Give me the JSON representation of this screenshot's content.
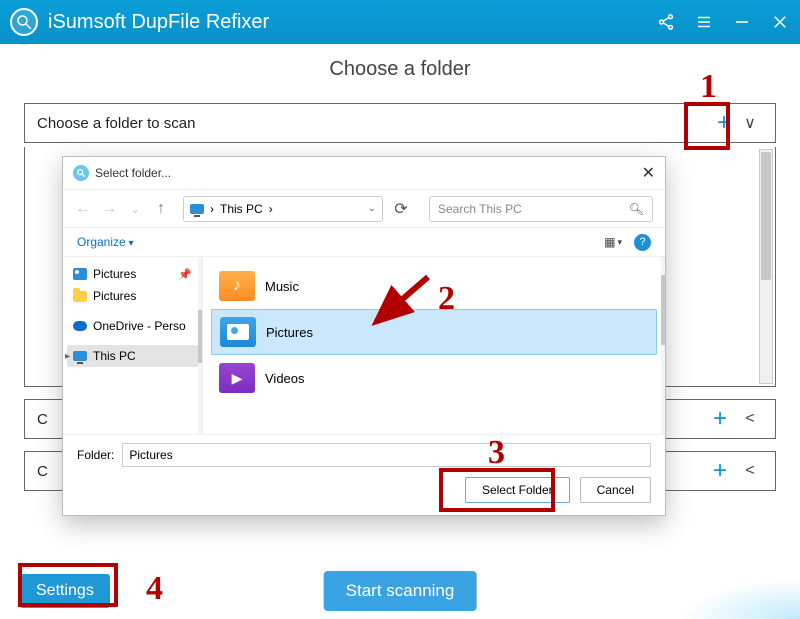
{
  "titlebar": {
    "app_name": "iSumsoft DupFile Refixer"
  },
  "main": {
    "heading": "Choose a folder",
    "row1_label": "Choose a folder to scan",
    "row2_left": "C",
    "row3_left": "C"
  },
  "dialog": {
    "title": "Select folder...",
    "path_location": "This PC",
    "path_sep": "›",
    "search_placeholder": "Search This PC",
    "organize": "Organize",
    "nav": {
      "quick_pictures": "Pictures",
      "folder_pictures": "Pictures",
      "onedrive": "OneDrive - Perso",
      "this_pc": "This PC"
    },
    "items": {
      "music": "Music",
      "pictures": "Pictures",
      "videos": "Videos"
    },
    "folder_label": "Folder:",
    "folder_value": "Pictures",
    "select_btn": "Select Folder",
    "cancel_btn": "Cancel",
    "help": "?"
  },
  "bottom": {
    "settings": "Settings",
    "start": "Start scanning"
  },
  "annotations": {
    "n1": "1",
    "n2": "2",
    "n3": "3",
    "n4": "4"
  }
}
